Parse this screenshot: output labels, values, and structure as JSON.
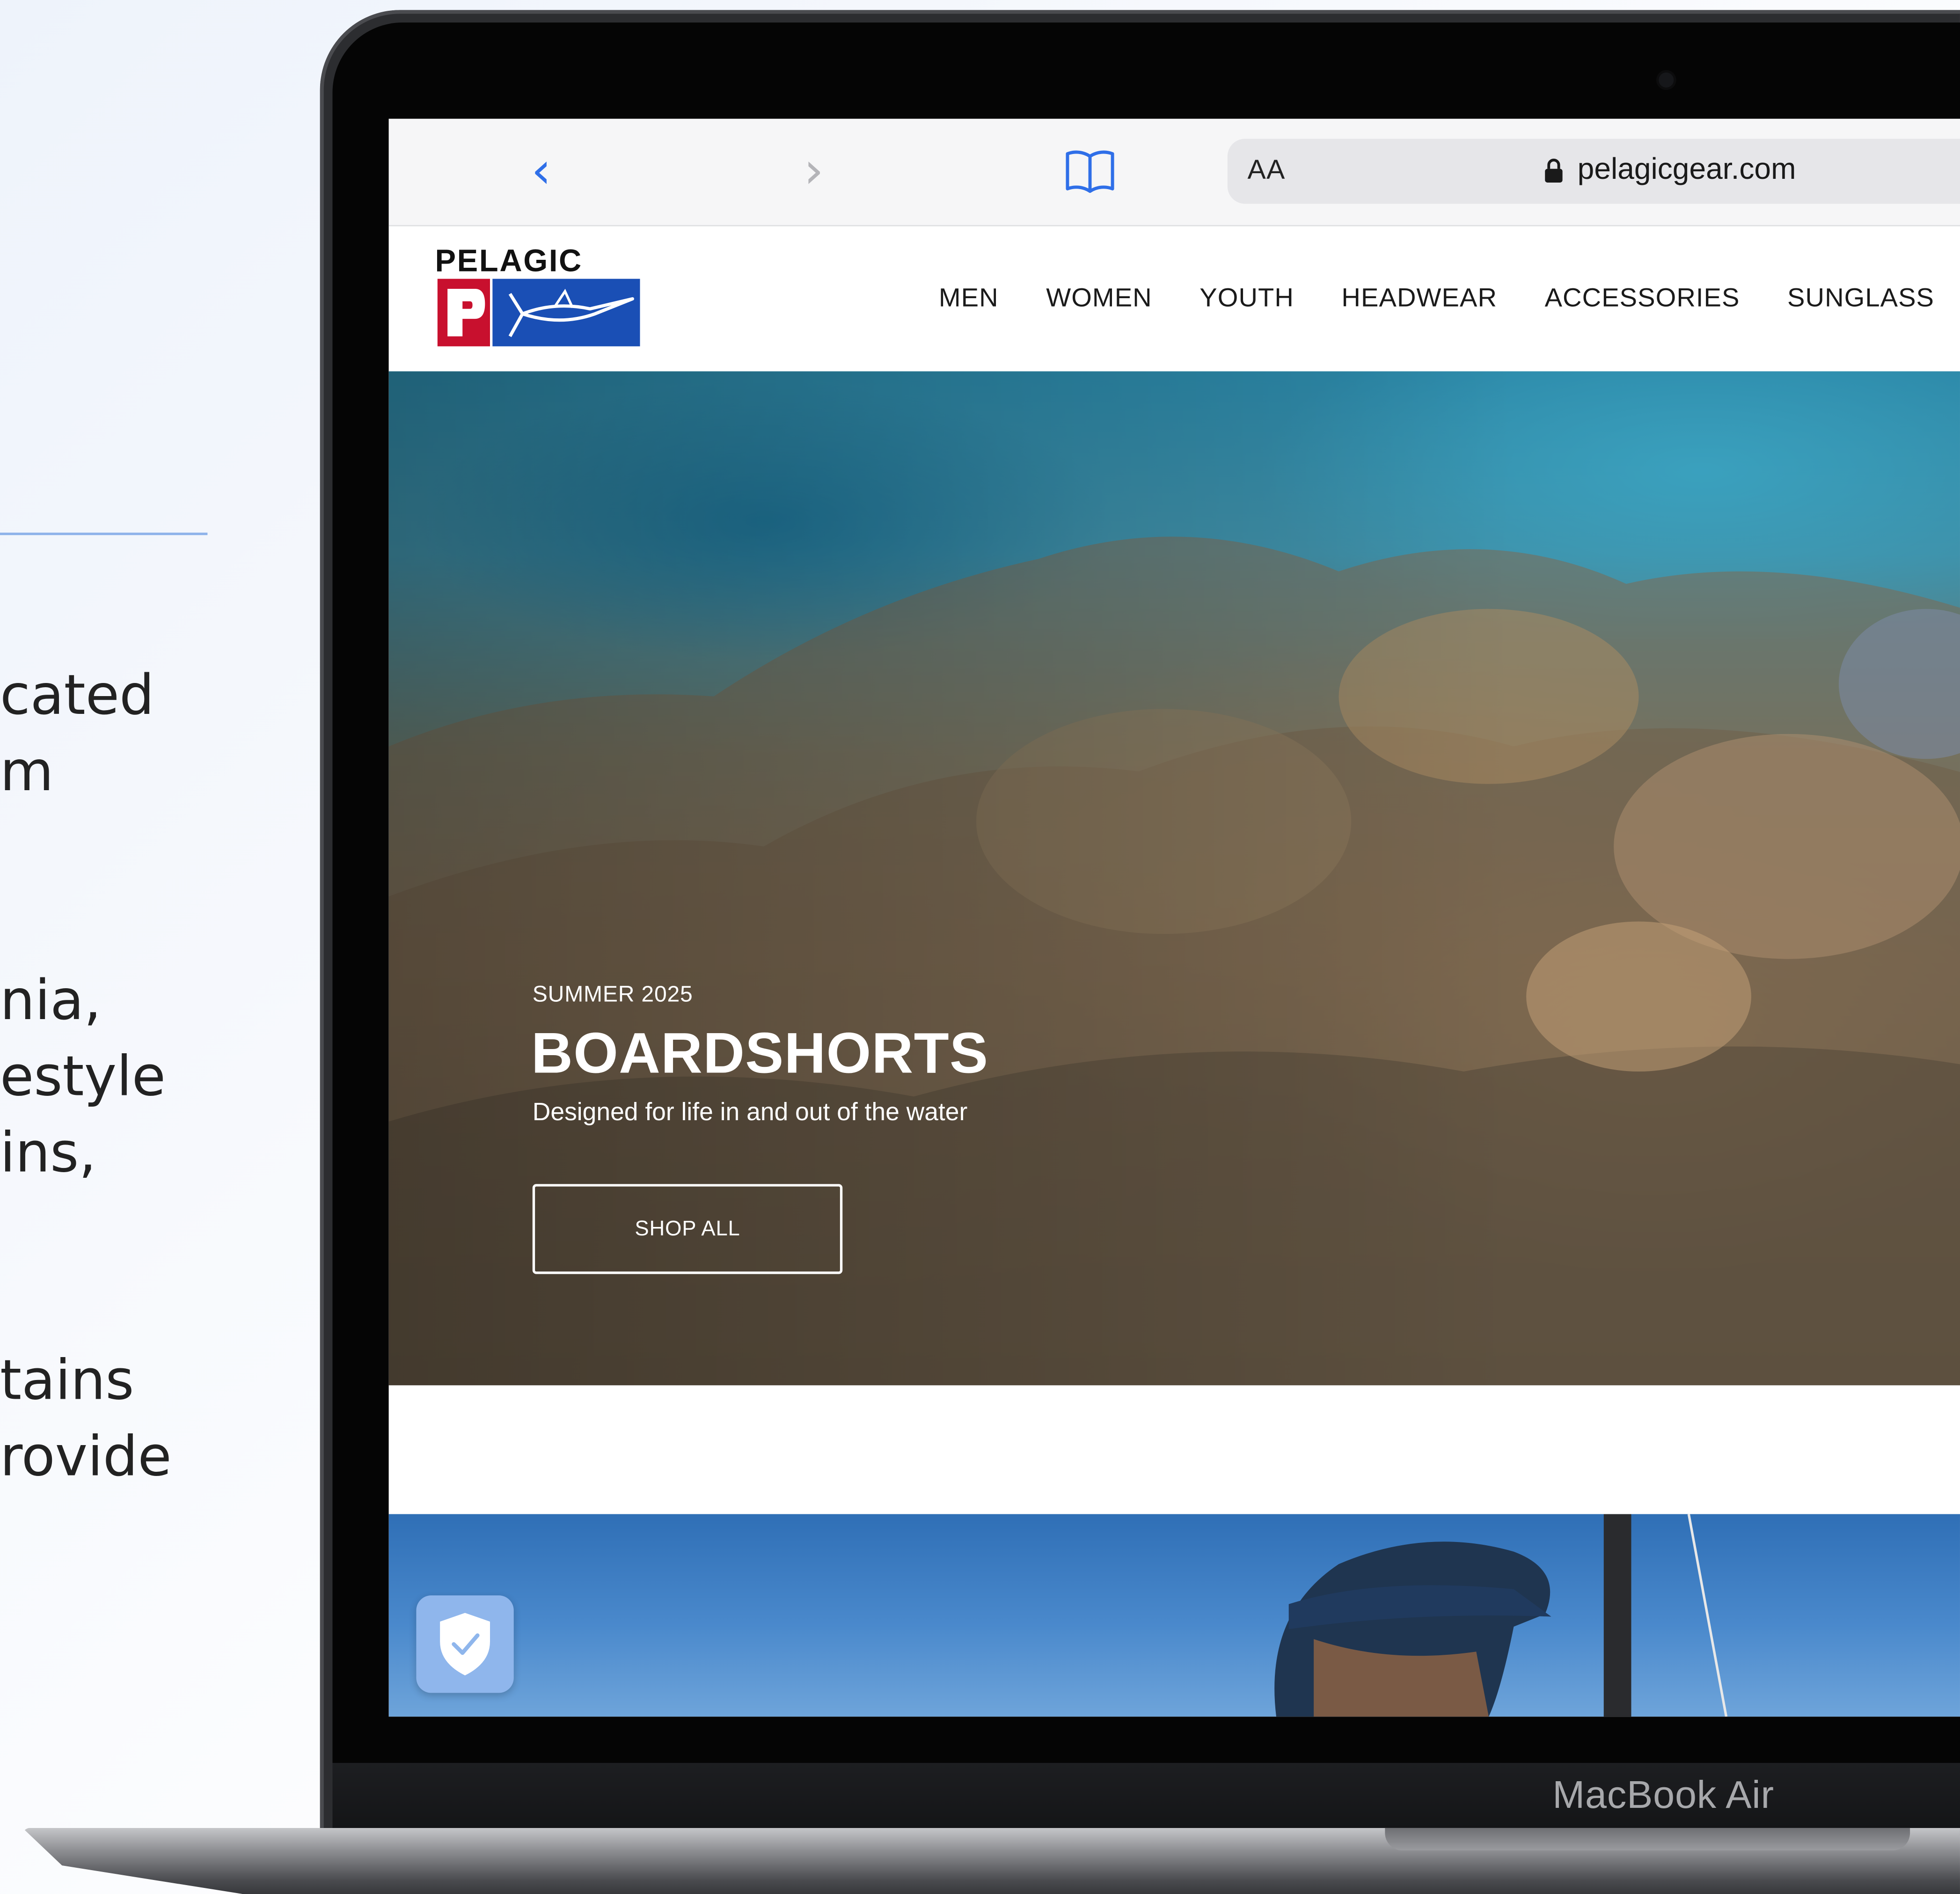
{
  "side_text": {
    "line1": "cated",
    "line2": "m",
    "line3": "nia,",
    "line4": "estyle",
    "line5": "ins,",
    "line6": "tains",
    "line7": "rovide"
  },
  "device": {
    "label": "MacBook Air"
  },
  "browser": {
    "text_size_button": "AA",
    "url": "pelagicgear.com"
  },
  "site": {
    "logo_text": "PELAGIC",
    "nav": [
      "MEN",
      "WOMEN",
      "YOUTH",
      "HEADWEAR",
      "ACCESSORIES",
      "SUNGLASS"
    ]
  },
  "hero": {
    "kicker": "SUMMER 2025",
    "title": "BOARDSHORTS",
    "subtitle": "Designed for life in and out of the water",
    "cta": "SHOP ALL"
  },
  "colors": {
    "accent_blue": "#2f6fe8",
    "logo_red": "#c8102e",
    "logo_blue": "#1a4fb5",
    "shield_badge": "#8fb6ec"
  },
  "icons": [
    "back-chevron-icon",
    "forward-chevron-icon",
    "bookmarks-book-icon",
    "lock-icon",
    "marlin-icon",
    "shield-check-icon"
  ]
}
